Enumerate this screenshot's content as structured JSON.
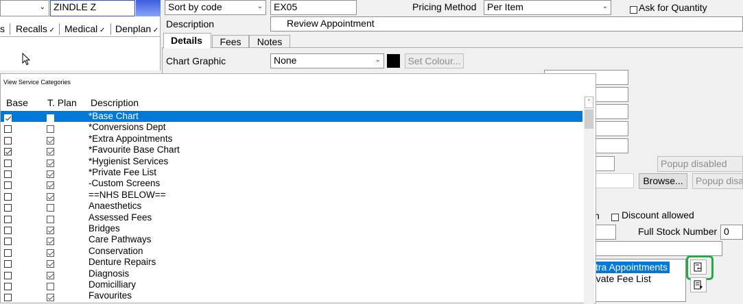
{
  "top": {
    "patient_name": "ZINDLE Z",
    "sort_combo": "Sort by code",
    "code_value": "EX05",
    "pricing_method_label": "Pricing Method",
    "pricing_method_value": "Per Item",
    "ask_quantity_label": "Ask for Quantity",
    "description_label": "Description",
    "description_value": "Review Appointment"
  },
  "left_tabs": [
    {
      "label": "s"
    },
    {
      "label": "Recalls"
    },
    {
      "label": "Medical"
    },
    {
      "label": "Denplan"
    }
  ],
  "detail_tabs": [
    {
      "label": "Details"
    },
    {
      "label": "Fees"
    },
    {
      "label": "Notes"
    }
  ],
  "chart": {
    "label": "Chart Graphic",
    "value": "None",
    "set_colour_button": "Set Colour..."
  },
  "right_panel": {
    "popup_disabled_1": "Popup disabled",
    "popup_disabled_2": "Popup disa",
    "browse_button": "Browse...",
    "discount_prefix": "n",
    "discount_label": "Discount allowed",
    "full_stock_label": "Full Stock Number",
    "full_stock_value": "0",
    "list_items": [
      {
        "label": "xtra Appointments"
      },
      {
        "label": "rivate Fee List"
      }
    ]
  },
  "dialog": {
    "title": "View Service Categories",
    "headers": {
      "base": "Base",
      "tplan": "T. Plan",
      "description": "Description"
    },
    "rows": [
      {
        "description": "*Base Chart",
        "base": true,
        "tplan": false,
        "selected": true
      },
      {
        "description": "*Conversions Dept",
        "base": false,
        "tplan": false
      },
      {
        "description": "*Extra Appointments",
        "base": false,
        "tplan": true
      },
      {
        "description": "*Favourite Base Chart",
        "base": true,
        "tplan": true
      },
      {
        "description": "*Hygienist Services",
        "base": false,
        "tplan": true
      },
      {
        "description": "*Private Fee List",
        "base": false,
        "tplan": true
      },
      {
        "description": "-Custom Screens",
        "base": false,
        "tplan": true
      },
      {
        "description": "==NHS BELOW==",
        "base": false,
        "tplan": true
      },
      {
        "description": "Anaesthetics",
        "base": false,
        "tplan": false
      },
      {
        "description": "Assessed Fees",
        "base": false,
        "tplan": false
      },
      {
        "description": "Bridges",
        "base": false,
        "tplan": true
      },
      {
        "description": "Care Pathways",
        "base": false,
        "tplan": true
      },
      {
        "description": "Conservation",
        "base": false,
        "tplan": true
      },
      {
        "description": "Denture Repairs",
        "base": false,
        "tplan": true
      },
      {
        "description": "Diagnosis",
        "base": false,
        "tplan": true
      },
      {
        "description": "Domicilliary",
        "base": false,
        "tplan": false
      },
      {
        "description": "Favourites",
        "base": false,
        "tplan": true
      }
    ]
  }
}
